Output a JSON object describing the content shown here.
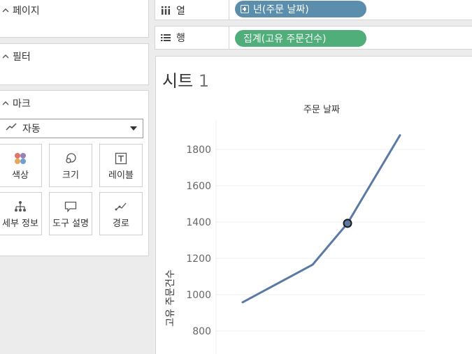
{
  "left_panel": {
    "pages": {
      "title": "페이지"
    },
    "filters": {
      "title": "필터"
    },
    "marks": {
      "title": "마크",
      "mark_type": "자동",
      "buttons": [
        {
          "label": "색상",
          "icon": "color-dots-icon"
        },
        {
          "label": "크기",
          "icon": "size-icon"
        },
        {
          "label": "레이블",
          "icon": "label-text-icon"
        },
        {
          "label": "세부 정보",
          "icon": "detail-icon"
        },
        {
          "label": "도구 설명",
          "icon": "tooltip-icon"
        },
        {
          "label": "경로",
          "icon": "path-icon"
        }
      ]
    }
  },
  "shelves": {
    "columns": {
      "label": "열",
      "pill": "년(주문 날짜)",
      "pill_color": "#5b8ead"
    },
    "rows": {
      "label": "행",
      "pill": "집계(고유 주문건수)",
      "pill_color": "#4fae7a"
    }
  },
  "sheet": {
    "title_text": "시트",
    "title_num": "1"
  },
  "chart_data": {
    "type": "line",
    "title": "주문 날짜",
    "xlabel": "",
    "ylabel": "고유 주문건수",
    "ylim": [
      720,
      1900
    ],
    "yticks": [
      800,
      1000,
      1200,
      1400,
      1600,
      1800
    ],
    "x": [
      0,
      1,
      2,
      3
    ],
    "series": [
      {
        "values": [
          958,
          1165,
          1393,
          1878
        ],
        "color": "#5a7aa3"
      }
    ],
    "highlighted_point_index": 2
  }
}
